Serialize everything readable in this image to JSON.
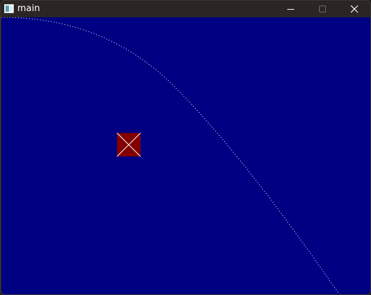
{
  "window": {
    "title": "main",
    "controls": {
      "minimize_icon": "minimize-icon",
      "maximize_icon": "maximize-icon",
      "close_icon": "close-icon"
    }
  },
  "canvas": {
    "background_color": "#000082",
    "trajectory": {
      "style": "dotted",
      "color": "#ffffff"
    },
    "box": {
      "fill_color": "#820000",
      "cross_color": "#ffffff"
    }
  }
}
